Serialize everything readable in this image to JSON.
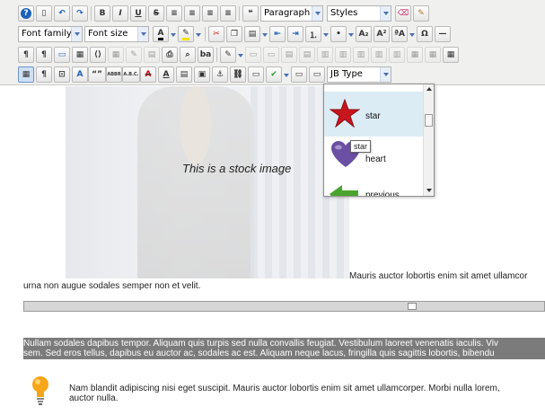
{
  "toolbar": {
    "format_select": "Paragraph",
    "styles_select": "Styles",
    "font_family_select": "Font family",
    "font_size_select": "Font size",
    "jb_type_select": "JB Type",
    "text_labels": {
      "bold": "B",
      "italic": "I",
      "underline": "U",
      "strike": "S",
      "subscript": "A₂",
      "superscript": "A²",
      "omega": "Ω",
      "quote": "“”",
      "abbr": "ABBR",
      "acronym": "A.B.C."
    }
  },
  "dropdown": {
    "items": [
      {
        "label": "star",
        "icon": "star-icon"
      },
      {
        "label": "heart",
        "icon": "heart-icon"
      },
      {
        "label": "previous",
        "icon": "left-arrow-icon"
      }
    ],
    "tooltip": "star"
  },
  "content": {
    "stock_caption": "This is a stock image",
    "line1": "Mauris auctor lobortis enim sit amet ullamcor",
    "line2": "urna non augue sodales semper non et velit.",
    "highlight_line1": "Nullam sodales dapibus tempor. Aliquam quis turpis sed nulla convallis feugiat. Vestibulum laoreet venenatis iaculis. Viv",
    "highlight_line2": "sem. Sed eros tellus, dapibus eu auctor ac, sodales ac est. Aliquam neque lacus, fringilla quis sagittis lobortis, bibendu",
    "tip_line1": "Nam blandit adipiscing nisi eget suscipit. Mauris auctor lobortis enim sit amet ullamcorper. Morbi nulla lorem,",
    "tip_line2": "auctor nulla."
  },
  "colors": {
    "toolbar_bg": "#f0f0ee",
    "highlight_bg": "#7b7b7b",
    "star": "#c8161d",
    "heart": "#6b4fa3",
    "arrow": "#49a52d",
    "dropdown_selected": "#dcecf5"
  }
}
